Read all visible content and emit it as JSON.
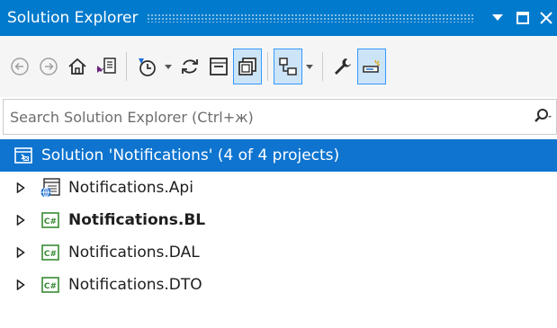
{
  "window": {
    "title": "Solution Explorer"
  },
  "search": {
    "placeholder": "Search Solution Explorer (Ctrl+ж)"
  },
  "tree": {
    "solution": {
      "label": "Solution 'Notifications' (4 of 4 projects)"
    },
    "projects": [
      {
        "label": "Notifications.Api",
        "icon": "web-project-icon",
        "bold": false
      },
      {
        "label": "Notifications.BL",
        "icon": "csharp-project-icon",
        "bold": true
      },
      {
        "label": "Notifications.DAL",
        "icon": "csharp-project-icon",
        "bold": false
      },
      {
        "label": "Notifications.DTO",
        "icon": "csharp-project-icon",
        "bold": false
      }
    ]
  },
  "colors": {
    "titlebar": "#007acc",
    "selection": "#0e74d0",
    "toolbar": "#f5f5f5",
    "csharp_icon": "#388a34"
  }
}
